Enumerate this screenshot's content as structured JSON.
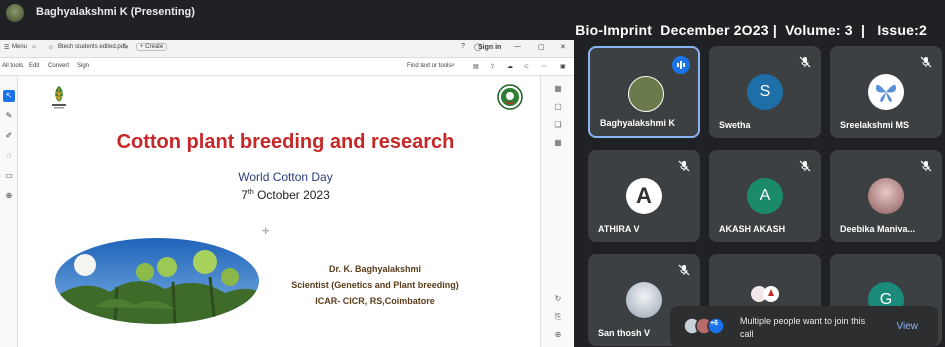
{
  "header": {
    "presenter": "Baghyalakshmi K (Presenting)",
    "journal": "Bio-Imprint  December 2O23 |  Volume: 3  |   Issue:2"
  },
  "pdf": {
    "tab_menu": "Menu",
    "tab_file": "Btech students edited.pdf",
    "tab_create": "+ Create",
    "sign_in": "Sign in",
    "menu": [
      "All tools",
      "Edit",
      "Convert",
      "Sign"
    ],
    "find": "Find text or tools"
  },
  "slide": {
    "title": "Cotton plant breeding and research",
    "event": "World Cotton Day",
    "date_day": "7",
    "date_sup": "th",
    "date_rest": " October 2023",
    "author": "Dr. K. Baghyalakshmi",
    "designation": "Scientist (Genetics and Plant breeding)",
    "institute": "ICAR- CICR, RS,Coimbatore"
  },
  "participants": [
    {
      "name": "Baghyalakshmi K",
      "initial": "",
      "color": "#6b7a4a"
    },
    {
      "name": "Swetha",
      "initial": "S",
      "color": "#1e6fa8"
    },
    {
      "name": "Sreelakshmi MS",
      "initial": "",
      "color": "#ffffff"
    },
    {
      "name": "ATHIRA V",
      "initial": "A",
      "color": "#ffffff"
    },
    {
      "name": "AKASH AKASH",
      "initial": "A",
      "color": "#1b8a6b"
    },
    {
      "name": "Deebika Maniva...",
      "initial": "",
      "color": "#c9a0a0"
    },
    {
      "name": "San thosh V",
      "initial": "",
      "color": "#d8dde3"
    },
    {
      "name": "",
      "initial": "",
      "color": "#3c4043"
    },
    {
      "name": "",
      "initial": "G",
      "color": "#1a8a7a"
    }
  ],
  "toast": {
    "count": "+6",
    "message": "Multiple people want to join this call",
    "action": "View"
  }
}
